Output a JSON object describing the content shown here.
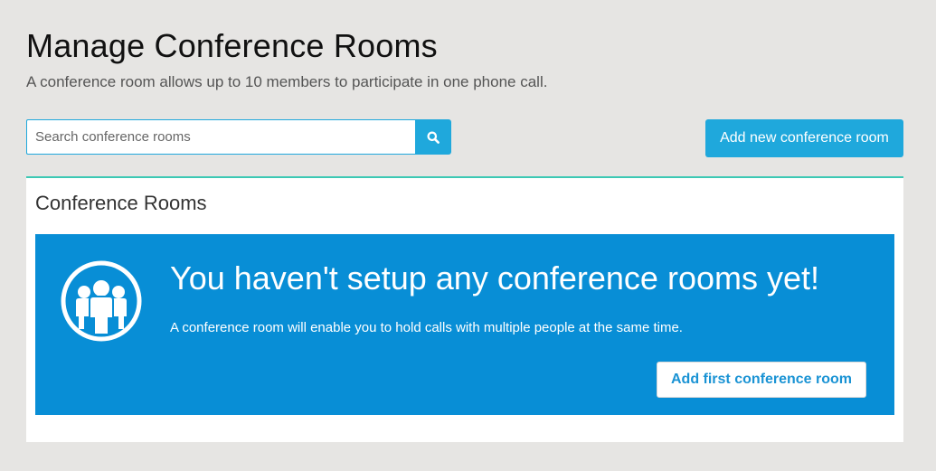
{
  "header": {
    "title": "Manage Conference Rooms",
    "subtitle": "A conference room allows up to 10 members to participate in one phone call."
  },
  "search": {
    "placeholder": "Search conference rooms",
    "value": "",
    "icon": "search-icon"
  },
  "toolbar": {
    "add_label": "Add new conference room"
  },
  "panel": {
    "title": "Conference Rooms",
    "empty_state": {
      "icon": "group-icon",
      "heading": "You haven't setup any conference rooms yet!",
      "text": "A conference room will enable you to hold calls with multiple people at the same time.",
      "button_label": "Add first conference room"
    }
  },
  "colors": {
    "accent": "#1fa8dc",
    "empty_bg": "#088ed6",
    "panel_border": "#3cc8b4",
    "page_bg": "#e6e5e3"
  }
}
